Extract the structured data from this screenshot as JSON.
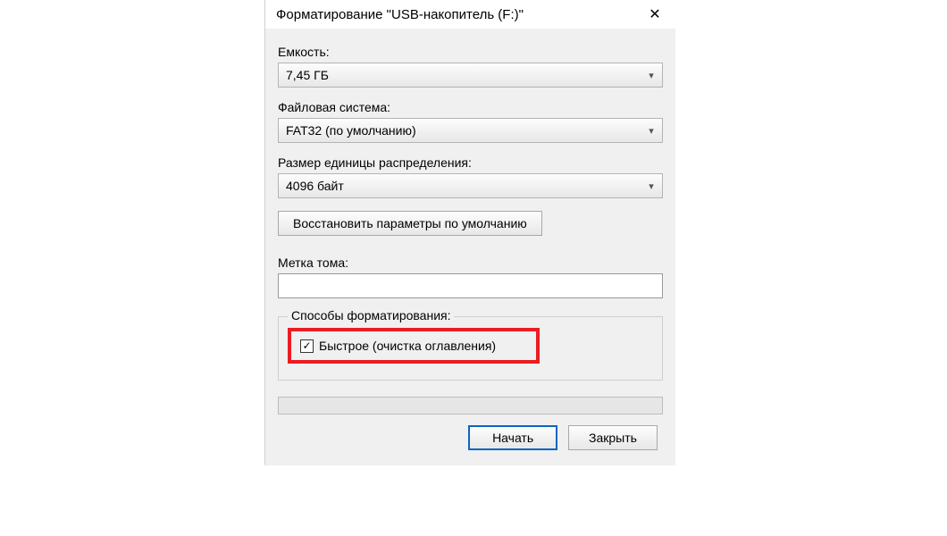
{
  "dialog": {
    "title": "Форматирование \"USB-накопитель (F:)\""
  },
  "capacity": {
    "label": "Емкость:",
    "value": "7,45 ГБ"
  },
  "filesystem": {
    "label": "Файловая система:",
    "value": "FAT32 (по умолчанию)"
  },
  "allocation": {
    "label": "Размер единицы распределения:",
    "value": "4096 байт"
  },
  "restore_defaults": {
    "label": "Восстановить параметры по умолчанию"
  },
  "volume_label": {
    "label": "Метка тома:",
    "value": ""
  },
  "format_options": {
    "legend": "Способы форматирования:",
    "quick": {
      "label": "Быстрое (очистка оглавления)",
      "checked": true
    }
  },
  "buttons": {
    "start": "Начать",
    "close": "Закрыть"
  }
}
